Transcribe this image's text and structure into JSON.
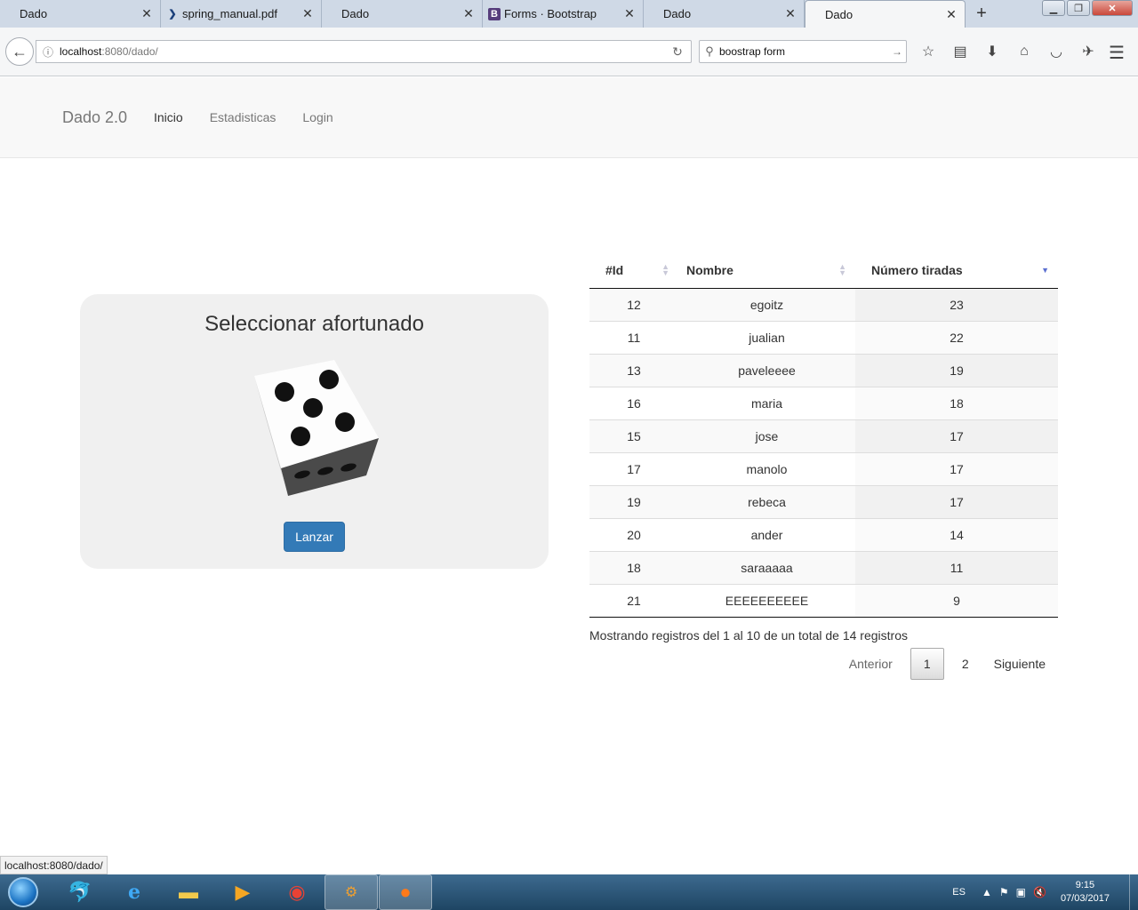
{
  "browser": {
    "tabs": [
      {
        "label": "Dado",
        "icon": "none"
      },
      {
        "label": "spring_manual.pdf",
        "icon": "chevron-icon"
      },
      {
        "label": "Dado",
        "icon": "none"
      },
      {
        "label": "Forms · Bootstrap",
        "icon": "bootstrap-icon"
      },
      {
        "label": "Dado",
        "icon": "none"
      },
      {
        "label": "Dado",
        "icon": "none",
        "active": true
      }
    ],
    "url_host": "localhost",
    "url_rest": ":8080/dado/",
    "search_value": "boostrap form"
  },
  "nav": {
    "brand": "Dado 2.0",
    "links": [
      "Inicio",
      "Estadisticas",
      "Login"
    ]
  },
  "dice": {
    "title": "Seleccionar afortunado",
    "button": "Lanzar"
  },
  "table": {
    "headers": [
      "#Id",
      "Nombre",
      "Número tiradas"
    ],
    "rows": [
      [
        "12",
        "egoitz",
        "23"
      ],
      [
        "11",
        "jualian",
        "22"
      ],
      [
        "13",
        "paveleeee",
        "19"
      ],
      [
        "16",
        "maria",
        "18"
      ],
      [
        "15",
        "jose",
        "17"
      ],
      [
        "17",
        "manolo",
        "17"
      ],
      [
        "19",
        "rebeca",
        "17"
      ],
      [
        "20",
        "ander",
        "14"
      ],
      [
        "18",
        "saraaaaa",
        "11"
      ],
      [
        "21",
        "EEEEEEEEEE",
        "9"
      ]
    ],
    "info": "Mostrando registros del 1 al 10 de un total de 14 registros",
    "pager": {
      "prev": "Anterior",
      "pages": [
        "1",
        "2"
      ],
      "next": "Siguiente"
    }
  },
  "statusbar": {
    "text": "localhost:8080/dado/"
  },
  "taskbar": {
    "apps": [
      "mysql-workbench-icon",
      "internet-explorer-icon",
      "file-explorer-icon",
      "media-player-icon",
      "chrome-icon",
      "java-ee-ide-icon",
      "firefox-icon"
    ],
    "lang": "ES",
    "time": "9:15",
    "date": "07/03/2017"
  }
}
